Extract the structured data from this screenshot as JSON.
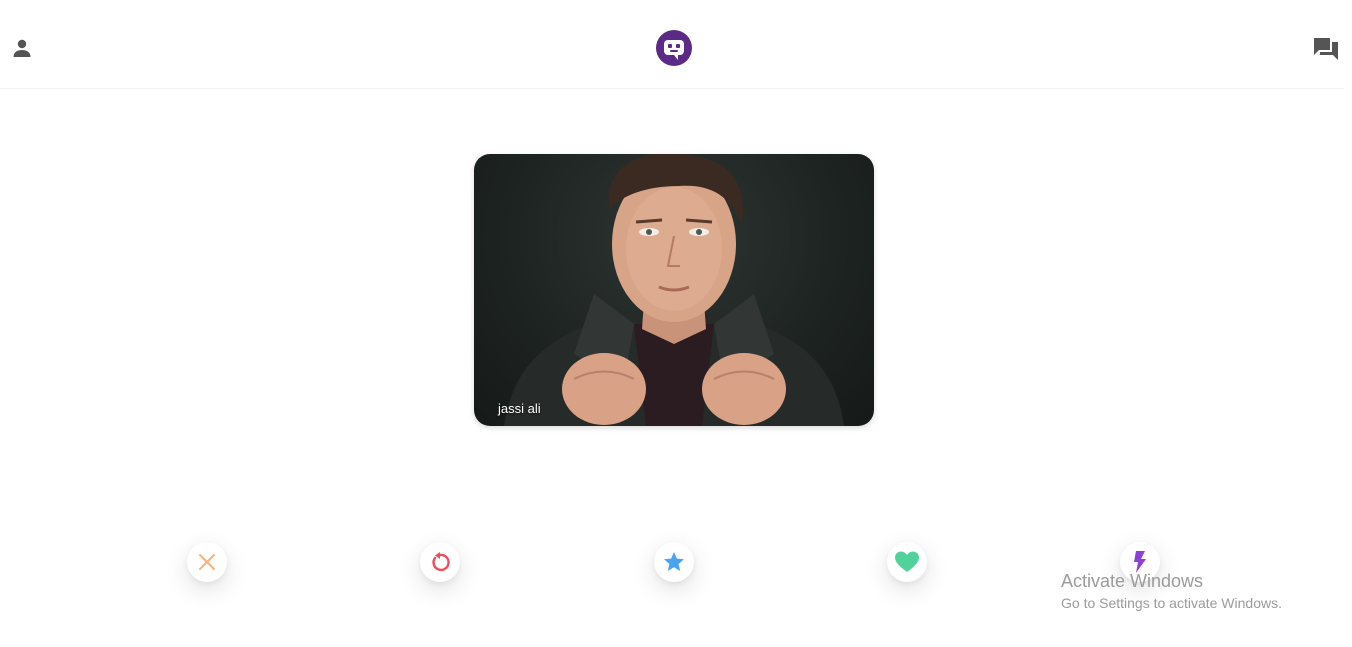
{
  "header": {
    "left_icon": "person-icon",
    "logo_icon": "chat-logo-icon",
    "right_icon": "forum-icon",
    "brand_color": "#5b2a86"
  },
  "card": {
    "name": "jassi ali",
    "image": "profile-photo"
  },
  "actions": [
    {
      "name": "close",
      "icon": "close-icon",
      "color": "#f5b37e"
    },
    {
      "name": "undo",
      "icon": "undo-icon",
      "color": "#e8505b"
    },
    {
      "name": "star",
      "icon": "star-icon",
      "color": "#4aa3ef"
    },
    {
      "name": "heart",
      "icon": "heart-icon",
      "color": "#4fd39b"
    },
    {
      "name": "bolt",
      "icon": "bolt-icon",
      "color": "#8e3fd8"
    }
  ],
  "watermark": {
    "title": "Activate Windows",
    "subtitle": "Go to Settings to activate Windows."
  }
}
